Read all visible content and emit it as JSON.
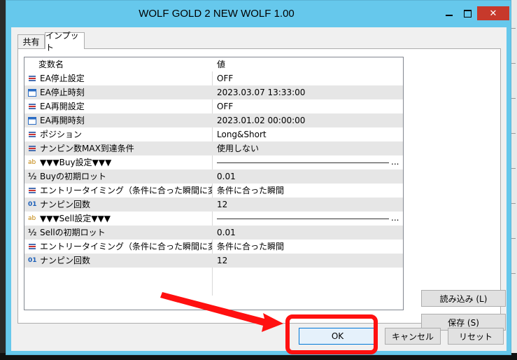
{
  "window": {
    "title": "WOLF GOLD 2 NEW WOLF 1.00",
    "close_glyph": "✕"
  },
  "tabs": [
    {
      "label": "共有",
      "active": false
    },
    {
      "label": "インプット",
      "active": true
    }
  ],
  "grid": {
    "headers": {
      "name": "変数名",
      "value": "値"
    },
    "rows": [
      {
        "icon": "enum-icon",
        "name": "EA停止設定",
        "value": "OFF"
      },
      {
        "icon": "calendar-icon",
        "name": "EA停止時刻",
        "value": "2023.03.07 13:33:00"
      },
      {
        "icon": "enum-icon",
        "name": "EA再開設定",
        "value": "OFF"
      },
      {
        "icon": "calendar-icon",
        "name": "EA再開時刻",
        "value": "2023.01.02 00:00:00"
      },
      {
        "icon": "enum-icon",
        "name": "ポジション",
        "value": "Long&Short"
      },
      {
        "icon": "enum-icon",
        "name": "ナンピン数MAX到達条件",
        "value": "使用しない"
      },
      {
        "icon": "string-icon",
        "name": "▼▼▼Buy設定▼▼▼",
        "value": "..."
      },
      {
        "icon": "double-icon",
        "name": "Buyの初期ロット",
        "value": "0.01"
      },
      {
        "icon": "enum-icon",
        "name": "エントリータイミング（条件に合った瞬間に変更す...",
        "value": "条件に合った瞬間"
      },
      {
        "icon": "integer-icon",
        "name": "ナンピン回数",
        "value": "12"
      },
      {
        "icon": "string-icon",
        "name": "▼▼▼Sell設定▼▼▼",
        "value": "..."
      },
      {
        "icon": "double-icon",
        "name": "Sellの初期ロット",
        "value": "0.01"
      },
      {
        "icon": "enum-icon",
        "name": "エントリータイミング（条件に合った瞬間に変更す...",
        "value": "条件に合った瞬間"
      },
      {
        "icon": "integer-icon",
        "name": "ナンピン回数",
        "value": "12"
      }
    ]
  },
  "side_buttons": {
    "load": "読み込み (L)",
    "save": "保存 (S)"
  },
  "footer_buttons": {
    "ok": "OK",
    "cancel": "キャンセル",
    "reset": "リセット"
  },
  "icon_glyphs": {
    "string": "ab",
    "double": "½",
    "integer": "01"
  },
  "colors": {
    "titlebar": "#66c8ec",
    "close": "#c7392b",
    "annotation": "#ff1010",
    "row_alt": "#e6e6e6"
  }
}
